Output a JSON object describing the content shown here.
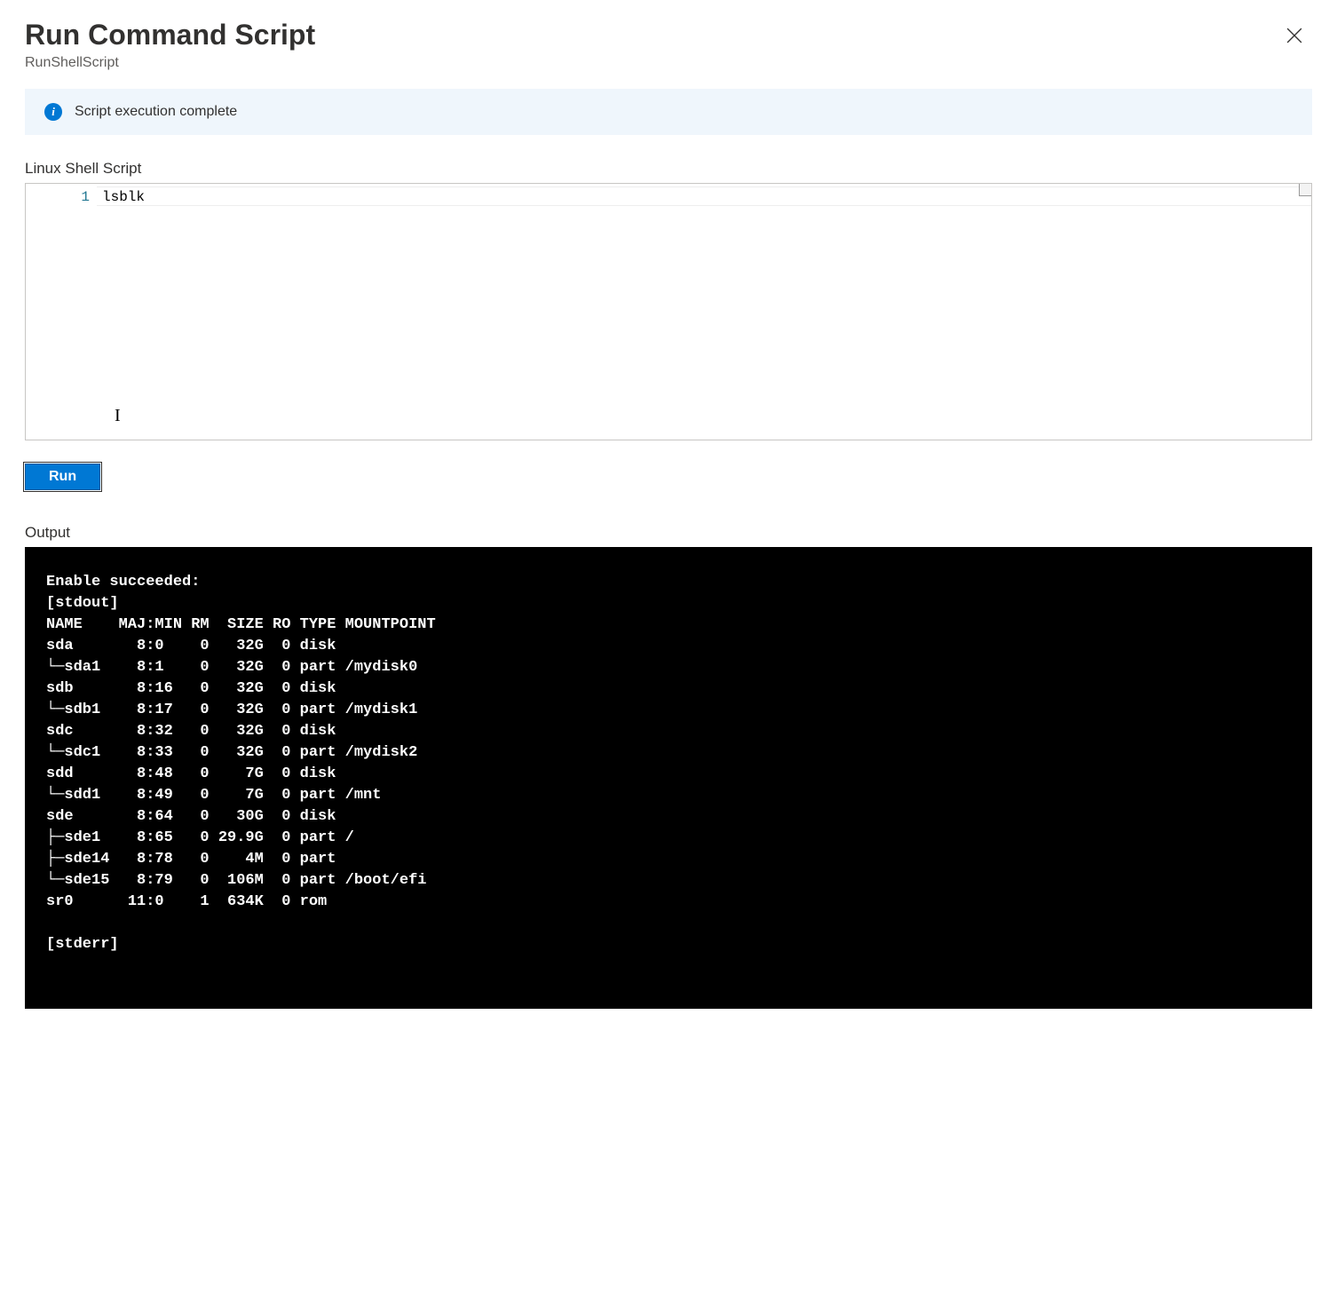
{
  "header": {
    "title": "Run Command Script",
    "subtitle": "RunShellScript"
  },
  "status": {
    "message": "Script execution complete"
  },
  "editor": {
    "label": "Linux Shell Script",
    "lines": [
      {
        "num": "1",
        "text": "lsblk"
      }
    ]
  },
  "actions": {
    "run_label": "Run"
  },
  "output": {
    "label": "Output",
    "text": "Enable succeeded: \n[stdout]\nNAME    MAJ:MIN RM  SIZE RO TYPE MOUNTPOINT\nsda       8:0    0   32G  0 disk \n└─sda1    8:1    0   32G  0 part /mydisk0\nsdb       8:16   0   32G  0 disk \n└─sdb1    8:17   0   32G  0 part /mydisk1\nsdc       8:32   0   32G  0 disk \n└─sdc1    8:33   0   32G  0 part /mydisk2\nsdd       8:48   0    7G  0 disk \n└─sdd1    8:49   0    7G  0 part /mnt\nsde       8:64   0   30G  0 disk \n├─sde1    8:65   0 29.9G  0 part /\n├─sde14   8:78   0    4M  0 part \n└─sde15   8:79   0  106M  0 part /boot/efi\nsr0      11:0    1  634K  0 rom  \n\n[stderr]"
  }
}
